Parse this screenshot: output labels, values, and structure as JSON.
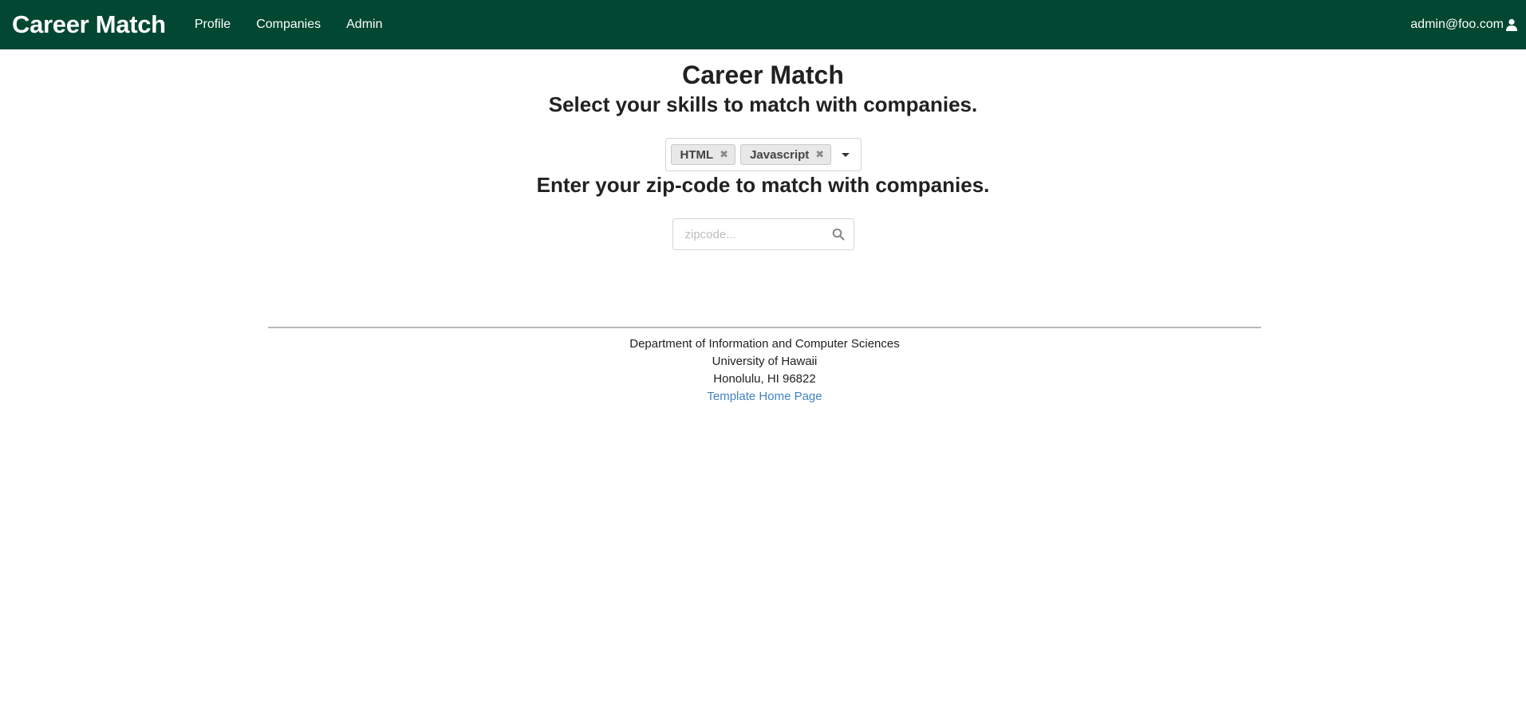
{
  "navbar": {
    "brand": "Career Match",
    "items": [
      {
        "label": "Profile"
      },
      {
        "label": "Companies"
      },
      {
        "label": "Admin"
      }
    ],
    "user_email": "admin@foo.com",
    "bg_color": "#024731",
    "user_icon": "user-icon"
  },
  "main": {
    "title": "Career Match",
    "skills_heading": "Select your skills to match with companies.",
    "skills": [
      {
        "label": "HTML"
      },
      {
        "label": "Javascript"
      }
    ],
    "zip_heading": "Enter your zip-code to match with companies.",
    "zip": {
      "placeholder": "zipcode...",
      "value": "",
      "icon": "search-icon"
    }
  },
  "footer": {
    "line1": "Department of Information and Computer Sciences",
    "line2": "University of Hawaii",
    "line3": "Honolulu, HI 96822",
    "link": "Template Home Page",
    "link_color": "#4183c4"
  }
}
